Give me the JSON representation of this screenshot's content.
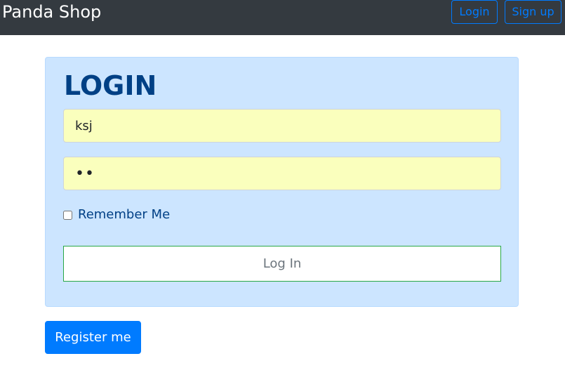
{
  "navbar": {
    "brand": "Panda Shop",
    "login_label": "Login",
    "signup_label": "Sign up"
  },
  "login_card": {
    "title": "LOGIN",
    "username_value": "ksj",
    "password_value": "••",
    "remember_label": "Remember Me",
    "remember_checked": false,
    "submit_label": "Log In"
  },
  "register_label": "Register me",
  "colors": {
    "navbar_bg": "#343a40",
    "card_bg": "#cce5ff",
    "card_text": "#004085",
    "autofill_bg": "#faffbd",
    "primary": "#007bff",
    "success": "#28a745"
  }
}
